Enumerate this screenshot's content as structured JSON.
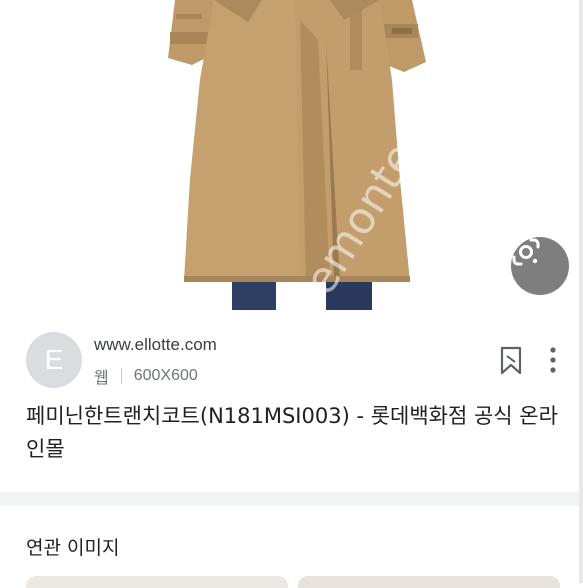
{
  "image_viewer": {
    "lens_icon": "google-lens-icon",
    "watermark": "/remonte"
  },
  "result": {
    "favicon_letter": "E",
    "site_url": "www.ellotte.com",
    "type_label": "웹",
    "dimensions": "600X600",
    "title": "페미닌한트랜치코트(N181MSI003) - 롯데백화점 공식 온라인몰",
    "bookmark_icon": "bookmark-icon",
    "more_icon": "more-vert-icon"
  },
  "related": {
    "heading": "연관 이미지"
  },
  "colors": {
    "coat": "#c39e6c",
    "coat_shadow": "#a9865a",
    "jeans": "#2f3f63",
    "favicon_bg": "#dadce0",
    "divider": "#f1f3f4"
  }
}
